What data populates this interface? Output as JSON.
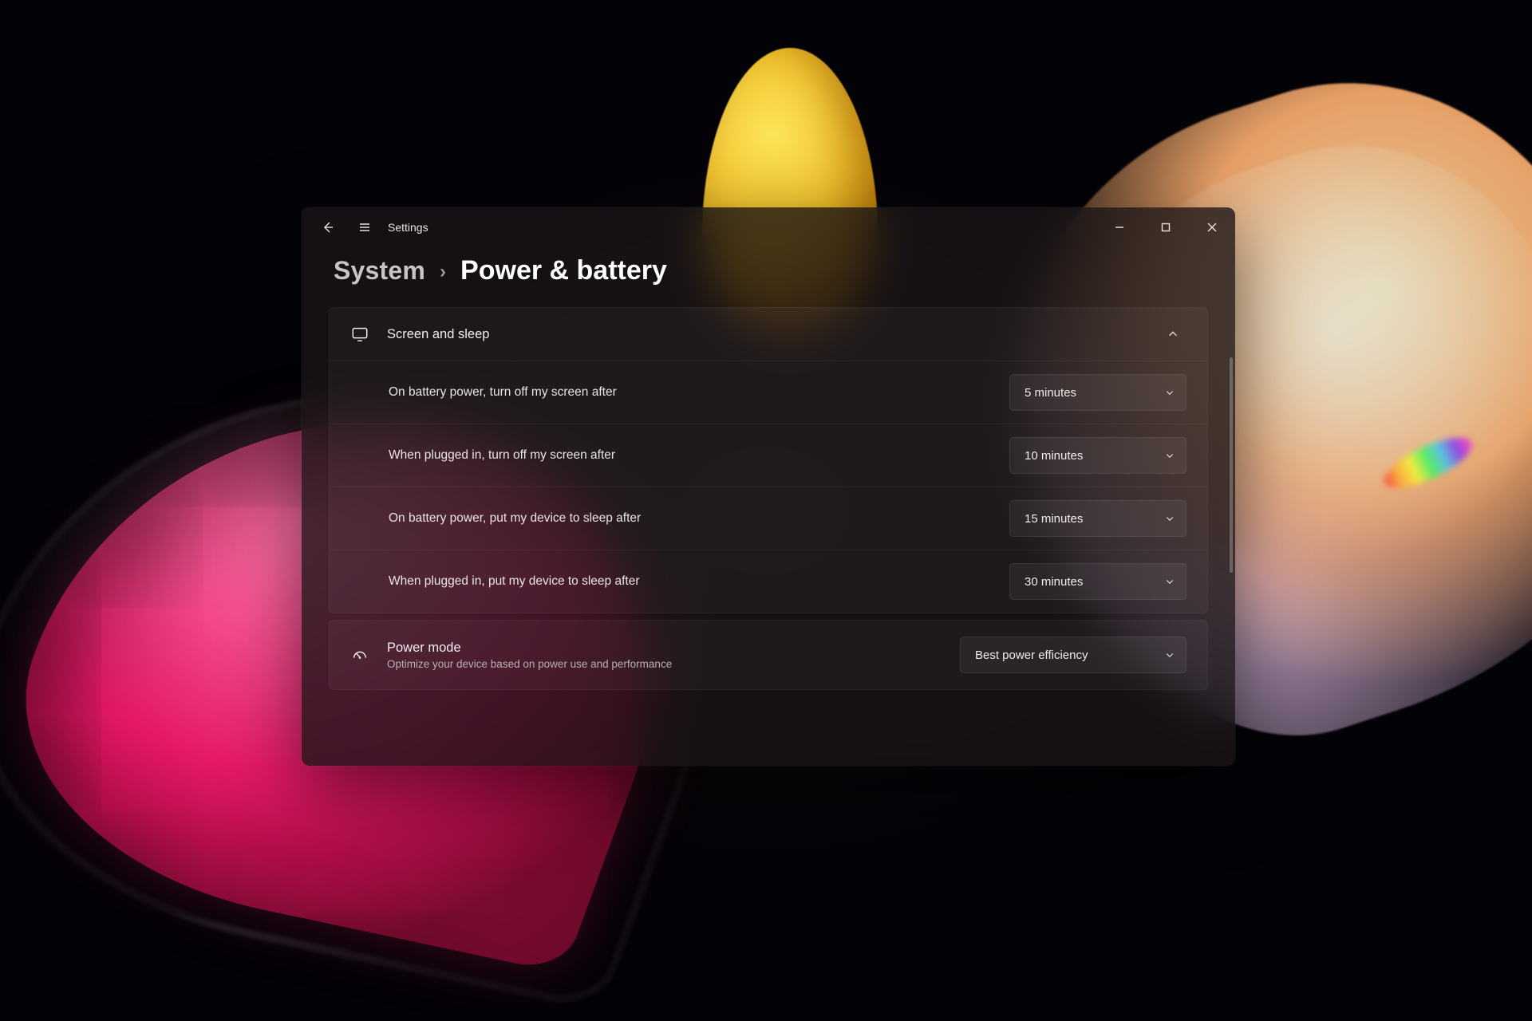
{
  "window": {
    "app_title": "Settings"
  },
  "breadcrumb": {
    "parent": "System",
    "current": "Power & battery"
  },
  "screen_sleep": {
    "header": "Screen and sleep",
    "rows": [
      {
        "label": "On battery power, turn off my screen after",
        "value": "5 minutes"
      },
      {
        "label": "When plugged in, turn off my screen after",
        "value": "10 minutes"
      },
      {
        "label": "On battery power, put my device to sleep after",
        "value": "15 minutes"
      },
      {
        "label": "When plugged in, put my device to sleep after",
        "value": "30 minutes"
      }
    ]
  },
  "power_mode": {
    "title": "Power mode",
    "subtitle": "Optimize your device based on power use and performance",
    "value": "Best power efficiency"
  }
}
